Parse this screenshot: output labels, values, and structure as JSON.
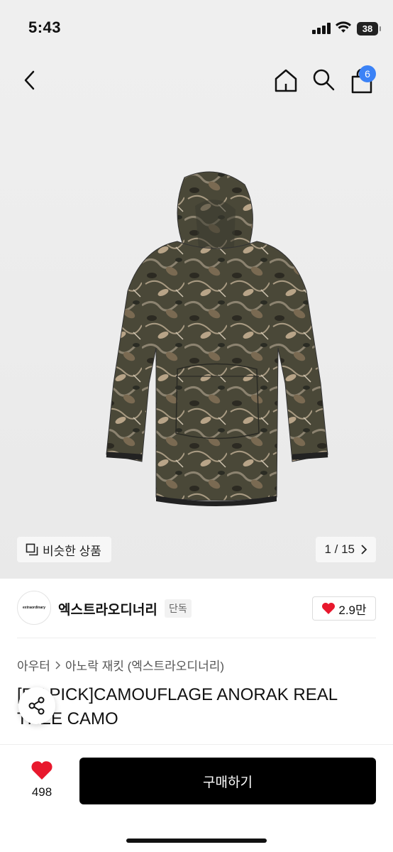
{
  "status": {
    "time": "5:43",
    "battery": "38"
  },
  "nav": {
    "cart_count": "6"
  },
  "gallery": {
    "similar_label": "비슷한 상품",
    "counter": "1 / 15"
  },
  "brand": {
    "logo_text": "extraordinary",
    "name": "엑스트라오디너리",
    "tag": "단독",
    "likes": "2.9만"
  },
  "breadcrumb": {
    "category": "아우터",
    "subcategory": "아노락 재킷 (엑스트라오디너리)"
  },
  "product": {
    "title": "[EX PICK]CAMOUFLAGE ANORAK REAL TREE CAMO"
  },
  "bottom": {
    "wish_count": "498",
    "buy_label": "구매하기"
  },
  "colors": {
    "accent": "#3b82f6",
    "heart": "#e8182d",
    "buy_bg": "#000000"
  }
}
